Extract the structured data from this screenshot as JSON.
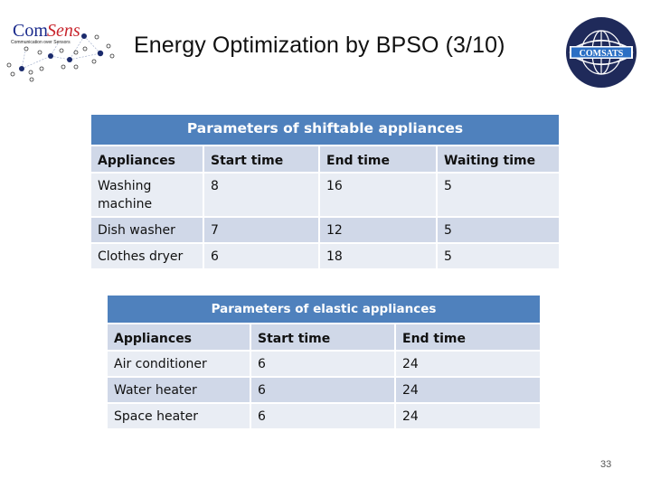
{
  "slide": {
    "title": "Energy Optimization by BPSO (3/10)",
    "page_number": "33"
  },
  "logos": {
    "left": {
      "name": "ComSens",
      "brand_prefix": "Com",
      "brand_suffix": "Sens",
      "tagline": "Communication over Sensors",
      "icon": "network-nodes-icon"
    },
    "right": {
      "name": "COMSATS",
      "icon": "globe-emblem-icon"
    }
  },
  "colors": {
    "caption_bg": "#4f81bd",
    "header_bg": "#d0d8e8",
    "row_light": "#e9edf4",
    "row_dark": "#d0d8e8",
    "comsats_navy": "#1f2a5a"
  },
  "shiftable": {
    "caption": "Parameters of shiftable appliances",
    "headers": [
      "Appliances",
      "Start time",
      "End time",
      "Waiting time"
    ],
    "rows": [
      [
        "Washing machine",
        "8",
        "16",
        "5"
      ],
      [
        "Dish washer",
        "7",
        "12",
        "5"
      ],
      [
        "Clothes dryer",
        "6",
        "18",
        "5"
      ]
    ]
  },
  "elastic": {
    "caption": "Parameters of elastic appliances",
    "headers": [
      "Appliances",
      "Start time",
      "End time"
    ],
    "rows": [
      [
        "Air conditioner",
        "6",
        "24"
      ],
      [
        "Water heater",
        "6",
        "24"
      ],
      [
        "Space heater",
        "6",
        "24"
      ]
    ]
  }
}
